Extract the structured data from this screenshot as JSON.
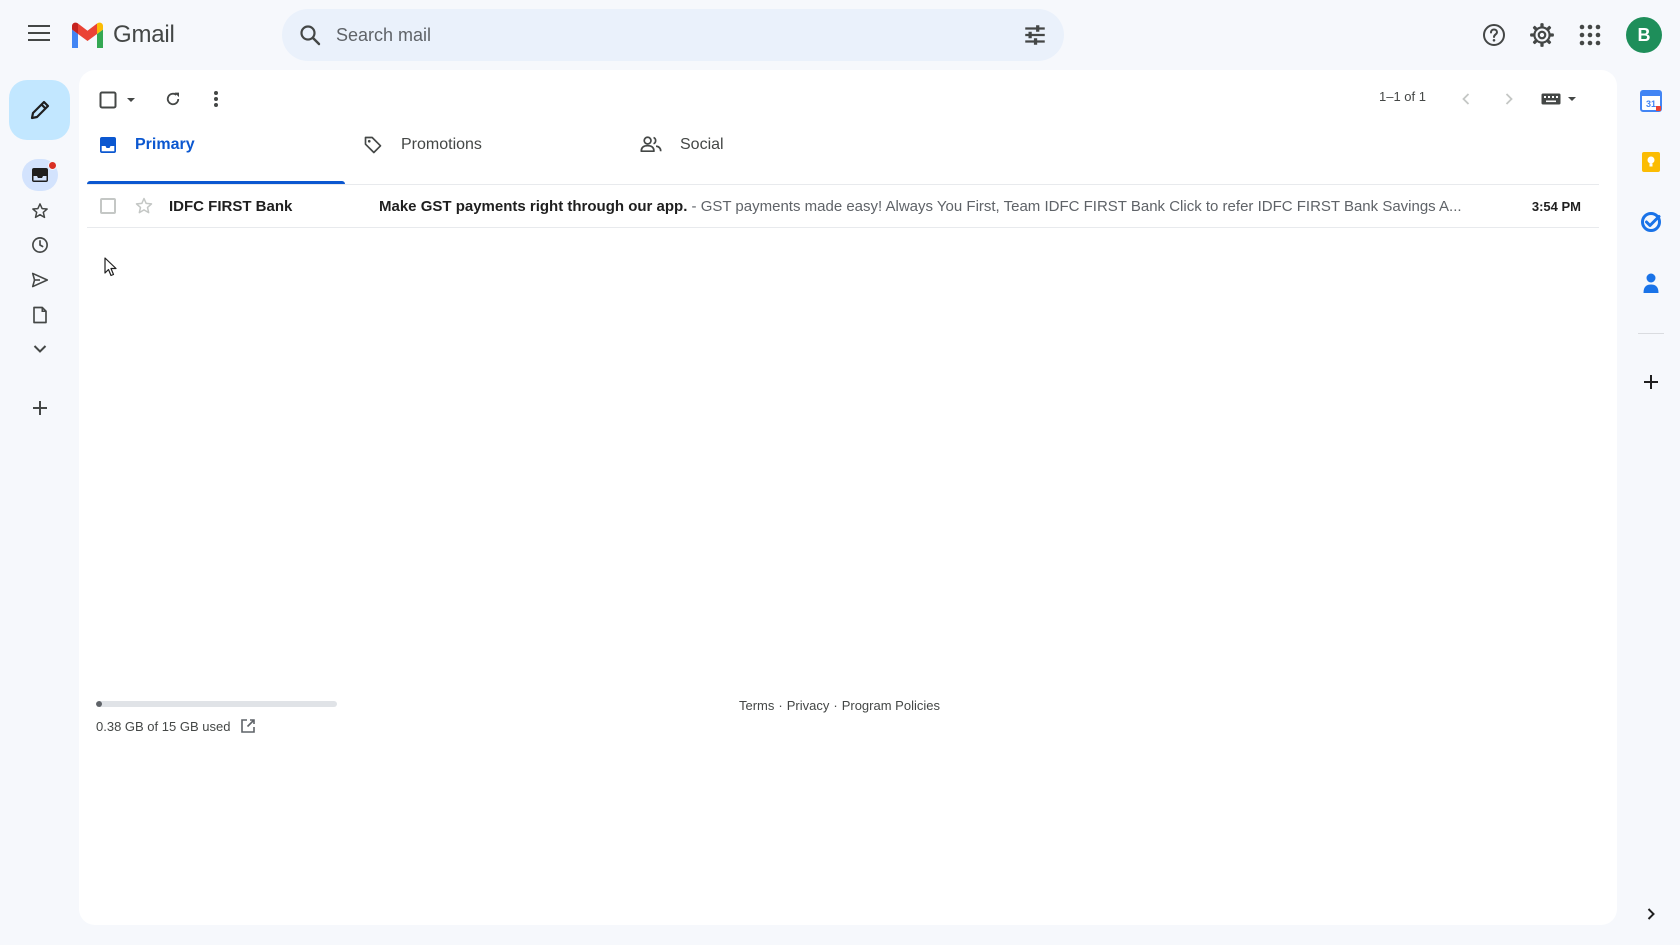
{
  "app": {
    "name": "Gmail"
  },
  "search": {
    "placeholder": "Search mail"
  },
  "user": {
    "avatar_initial": "B"
  },
  "toolbar": {
    "pagination": "1–1 of 1"
  },
  "tabs": [
    {
      "label": "Primary",
      "active": true
    },
    {
      "label": "Promotions",
      "active": false
    },
    {
      "label": "Social",
      "active": false
    }
  ],
  "emails": [
    {
      "sender": "IDFC FIRST Bank",
      "subject": "Make GST payments right through our app.",
      "separator": " - ",
      "snippet": "GST payments made easy! Always You First, Team IDFC FIRST Bank Click to refer IDFC FIRST Bank Savings A...",
      "time": "3:54 PM",
      "unread": true,
      "starred": false
    }
  ],
  "storage": {
    "text": "0.38 GB of 15 GB used",
    "fraction": 0.025
  },
  "footer": {
    "terms": "Terms",
    "sep1": "·",
    "privacy": "Privacy",
    "sep2": "·",
    "policies": "Program Policies"
  },
  "colors": {
    "accent": "#0b57d0",
    "compose_bg": "#c2e7ff",
    "avatar_bg": "#1e8e5a",
    "unread_badge": "#d93025"
  },
  "icons": {
    "menu": "hamburger-menu-icon",
    "search": "search-icon",
    "filters": "tune-icon",
    "help": "help-icon",
    "settings": "gear-icon",
    "apps": "apps-grid-icon",
    "compose": "pencil-icon",
    "inbox": "inbox-icon",
    "starred": "star-icon",
    "snoozed": "clock-icon",
    "sent": "send-icon",
    "drafts": "draft-icon",
    "more": "chevron-down-icon",
    "new_label": "plus-icon"
  }
}
